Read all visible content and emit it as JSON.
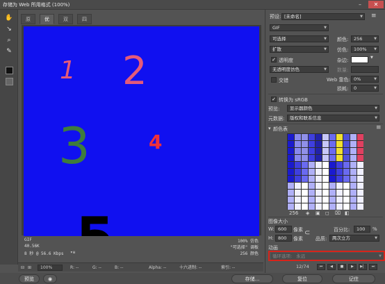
{
  "window": {
    "title": "存储为 Web 所用格式 (100%)",
    "close_label": "✕",
    "minimize_label": "–"
  },
  "tools": [
    "hand-icon",
    "slice-select-icon",
    "zoom-icon",
    "eyedropper-icon"
  ],
  "tabs": [
    "原稿",
    "优化",
    "双联",
    "四联"
  ],
  "canvas": {
    "digits": [
      "1",
      "2",
      "3",
      "4",
      "5"
    ],
    "background": "#1010f0"
  },
  "info": {
    "format": "GIF",
    "size": "40.56K",
    "time": "8 秒 @ 56.6 Kbps",
    "time_icon": "▾≡",
    "dither": "100% 仿色",
    "palette": "\"可选择\" 调板",
    "colors": "256 颜色"
  },
  "statusbar": {
    "zoom": "100%",
    "r": "R: --",
    "g": "G: --",
    "b": "B: --",
    "alpha": "Alpha: --",
    "hex": "十六进制: --",
    "index": "索引: --"
  },
  "bottom": {
    "preview": "预览",
    "save": "存储...",
    "reset": "复位",
    "remember": "记住"
  },
  "panel": {
    "preset_label": "预设:",
    "preset_value": "[未命名]",
    "format": "GIF",
    "reduction": "可选择",
    "colors_label": "颜色:",
    "colors_value": "256",
    "dither_algo": "扩散",
    "dither_label": "仿色:",
    "dither_value": "100%",
    "transparency": "透明度",
    "matte_label": "杂边:",
    "trans_dither": "无透明度仿色",
    "amount_label": "数量:",
    "interlaced": "交错",
    "websnap_label": "Web 靠色:",
    "websnap_value": "0%",
    "lossy_label": "损耗:",
    "lossy_value": "0",
    "convert_srgb": "转换为 sRGB",
    "preview_label": "预览:",
    "preview_value": "显示器颜色",
    "metadata_label": "元数据:",
    "metadata_value": "版权和联系信息",
    "color_table": "颜色表",
    "color_count": "256",
    "image_size": "图像大小",
    "w_label": "W:",
    "w_value": "600",
    "h_label": "H:",
    "h_value": "800",
    "px_unit": "像素",
    "percent_label": "百分比:",
    "percent_value": "100",
    "pct_sign": "%",
    "quality_label": "品质:",
    "quality_value": "两次立方",
    "animation": "动画",
    "loop_label": "循环选项:",
    "loop_value": "永远",
    "frame": "12/74"
  },
  "palette_colors": [
    "#1a1acf",
    "#3f3fe0",
    "#6a6af0",
    "#b0b0f8",
    "#f0f0ff",
    "#ffffff",
    "#d0d0ff",
    "#8888ee",
    "#2222aa",
    "#f0e030",
    "#e04060",
    "#3e7c3c",
    "#000000",
    "#ff2030",
    "#9090e8",
    "#c8c8f8",
    "#5050d8",
    "#e0e0ff",
    "#7070e0",
    "#a0a0f0"
  ]
}
